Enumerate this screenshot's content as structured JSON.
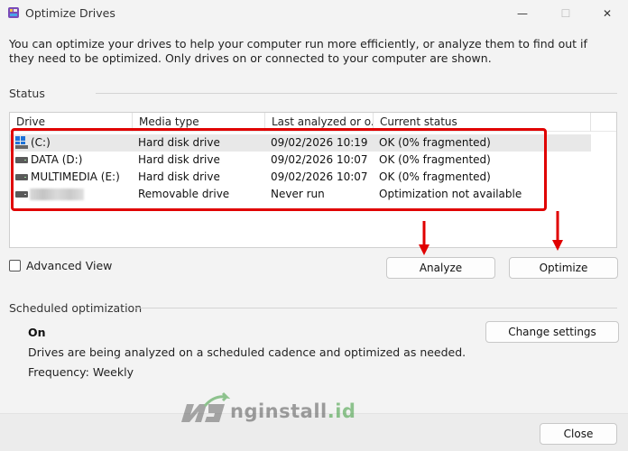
{
  "window": {
    "title": "Optimize Drives",
    "minimize_glyph": "—",
    "maximize_glyph": "☐",
    "close_glyph": "✕"
  },
  "intro_text": "You can optimize your drives to help your computer run more efficiently, or analyze them to find out if they need to be optimized. Only drives on or connected to your computer are shown.",
  "status": {
    "label": "Status",
    "columns": [
      "Drive",
      "Media type",
      "Last analyzed or o...",
      "Current status"
    ],
    "drives": [
      {
        "drive": "(C:)",
        "media_type": "Hard disk drive",
        "last_analyzed": "09/02/2026 10:19",
        "status": "OK (0% fragmented)",
        "icon": "windows-drive-icon",
        "selected": true
      },
      {
        "drive": "DATA (D:)",
        "media_type": "Hard disk drive",
        "last_analyzed": "09/02/2026 10:07",
        "status": "OK (0% fragmented)",
        "icon": "hard-drive-icon"
      },
      {
        "drive": "MULTIMEDIA (E:)",
        "media_type": "Hard disk drive",
        "last_analyzed": "09/02/2026 10:07",
        "status": "OK (0% fragmented)",
        "icon": "hard-drive-icon"
      },
      {
        "drive": "",
        "media_type": "Removable drive",
        "last_analyzed": "Never run",
        "status": "Optimization not available",
        "icon": "removable-drive-icon",
        "name_blurred": true
      }
    ]
  },
  "advanced_view": {
    "label": "Advanced View",
    "checked": false
  },
  "buttons": {
    "analyze": "Analyze",
    "optimize": "Optimize",
    "change_settings": "Change settings",
    "close": "Close"
  },
  "scheduled": {
    "label": "Scheduled optimization",
    "state": "On",
    "description": "Drives are being analyzed on a scheduled cadence and optimized as needed.",
    "frequency": "Frequency: Weekly"
  },
  "annotation_color": "#e00000",
  "watermark": {
    "text": "nginstall",
    "suffix": ".id"
  }
}
